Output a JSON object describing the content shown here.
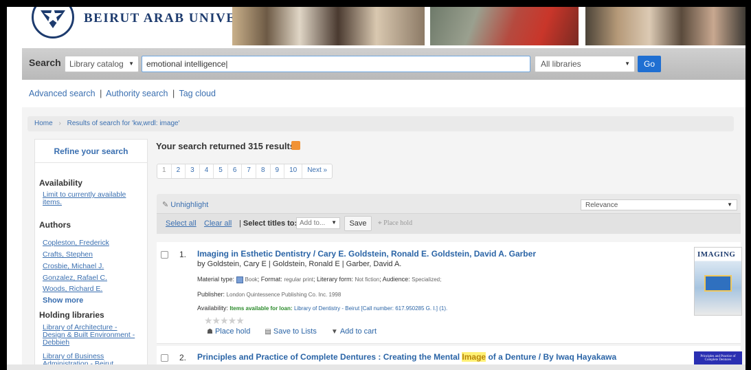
{
  "banner": {
    "university_name": "BEIRUT ARAB UNIVERSITY"
  },
  "search": {
    "label": "Search",
    "catalog_selected": "Library catalog",
    "query": "emotional intelligence",
    "libraries_selected": "All libraries",
    "go_label": "Go"
  },
  "links": {
    "advanced": "Advanced search",
    "authority": "Authority search",
    "tagcloud": "Tag cloud",
    "sep": "|"
  },
  "breadcrumb": {
    "home": "Home",
    "sep": "›",
    "current": "Results of search for 'kw,wrdl: image'"
  },
  "sidebar": {
    "refine": "Refine your search",
    "availability": "Availability",
    "limit_available": "Limit to currently available items.",
    "authors_heading": "Authors",
    "authors": [
      "Copleston, Frederick",
      "Crafts, Stephen",
      "Crosbie, Michael J.",
      "Gonzalez, Rafael C.",
      "Woods, Richard E."
    ],
    "show_more": "Show more",
    "holding_heading": "Holding libraries",
    "holdings": [
      "Library of Architecture - Design & Built Environment - Debbieh",
      "Library of Business Administration - Beirut"
    ]
  },
  "results": {
    "count_text": "Your search returned 315 results.",
    "pages": [
      "1",
      "2",
      "3",
      "4",
      "5",
      "6",
      "7",
      "8",
      "9",
      "10",
      "Next »"
    ],
    "unhighlight": "Unhighlight",
    "sort_selected": "Relevance",
    "select_all": "Select all",
    "clear_all": "Clear all",
    "select_titles_label": "Select titles to:",
    "add_to": "Add to...",
    "save": "Save",
    "place_hold_top": "Place hold",
    "items": [
      {
        "num": "1.",
        "title": "Imaging in Esthetic Dentistry / Cary E. Goldstein, Ronald E. Goldstein, David A. Garber",
        "by": "by Goldstein, Cary E | Goldstein, Ronald E | Garber, David A.",
        "material_label": "Material type:",
        "material_value": "Book",
        "format_label": "; Format:",
        "format_value": "regular print",
        "literary_label": "; Literary form:",
        "literary_value": "Not fiction",
        "audience_label": "; Audience:",
        "audience_value": "Specialized;",
        "publisher_label": "Publisher:",
        "publisher_value": "London Quintessence Publishing Co. Inc. 1998",
        "availability_label": "Availability:",
        "availability_status": "Items available for loan:",
        "availability_detail": "Library of Dentistry - Beirut [Call number: 617.950285 G. I.] (1).",
        "stars": "★★★★★",
        "actions": [
          "Place hold",
          "Save to Lists",
          "Add to cart"
        ],
        "cover_title": "IMAGING"
      },
      {
        "num": "2.",
        "title_before": "Principles and Practice of Complete Dentures : Creating the Mental ",
        "title_highlight": "Image",
        "title_after": " of a Denture / By Iwaq Hayakawa",
        "cover_title": "Principles and Practice of Complete Dentures"
      }
    ]
  }
}
